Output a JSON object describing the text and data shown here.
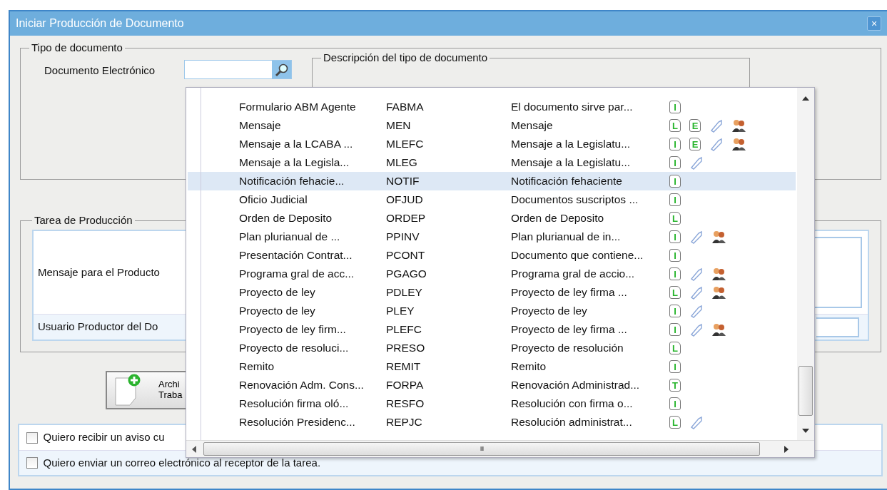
{
  "window": {
    "title": "Iniciar Producción de Documento",
    "close": "×"
  },
  "tipo_documento": {
    "legend": "Tipo de documento",
    "label": "Documento Electrónico",
    "descripcion_legend": "Descripción del tipo de documento"
  },
  "tarea": {
    "legend": "Tarea de Producción",
    "mensaje_label": "Mensaje para el Producto",
    "usuario_label": "Usuario Productor del Do"
  },
  "attach_button": {
    "line1": "Archi",
    "line2": "Traba"
  },
  "options": [
    {
      "label": "Quiero recibir un aviso cu",
      "checked": false
    },
    {
      "label": "Quiero enviar un correo electrónico al receptor de la tarea.",
      "checked": false
    }
  ],
  "dropdown": {
    "scroll_mark": "III",
    "rows": [
      {
        "name": "Formulario ABM Agente",
        "code": "FABMA",
        "description": "El documento sirve par...",
        "selected": false,
        "icons": [
          {
            "kind": "doc",
            "letter": "I"
          }
        ]
      },
      {
        "name": "Mensaje",
        "code": "MEN",
        "description": "Mensaje",
        "selected": false,
        "icons": [
          {
            "kind": "doc",
            "letter": "L"
          },
          {
            "kind": "doc",
            "letter": "E"
          },
          {
            "kind": "tag"
          },
          {
            "kind": "people"
          }
        ]
      },
      {
        "name": "Mensaje a la LCABA ...",
        "code": "MLEFC",
        "description": "Mensaje a la Legislatu...",
        "selected": false,
        "icons": [
          {
            "kind": "doc",
            "letter": "I"
          },
          {
            "kind": "doc",
            "letter": "E"
          },
          {
            "kind": "tag"
          },
          {
            "kind": "people"
          }
        ]
      },
      {
        "name": "Mensaje a la Legisla...",
        "code": "MLEG",
        "description": "Mensaje a la Legislatu...",
        "selected": false,
        "icons": [
          {
            "kind": "doc",
            "letter": "I"
          },
          {
            "kind": "tag"
          }
        ]
      },
      {
        "name": "Notificación fehacie...",
        "code": "NOTIF",
        "description": "Notificación fehaciente",
        "selected": true,
        "icons": [
          {
            "kind": "doc",
            "letter": "I"
          }
        ]
      },
      {
        "name": "Oficio Judicial",
        "code": "OFJUD",
        "description": "Documentos suscriptos ...",
        "selected": false,
        "icons": [
          {
            "kind": "doc",
            "letter": "I"
          }
        ]
      },
      {
        "name": "Orden de Deposito",
        "code": "ORDEP",
        "description": "Orden de Deposito",
        "selected": false,
        "icons": [
          {
            "kind": "doc",
            "letter": "L"
          }
        ]
      },
      {
        "name": "Plan plurianual de ...",
        "code": "PPINV",
        "description": "Plan plurianual de in...",
        "selected": false,
        "icons": [
          {
            "kind": "doc",
            "letter": "I"
          },
          {
            "kind": "tag"
          },
          {
            "kind": "people"
          }
        ]
      },
      {
        "name": "Presentación Contrat...",
        "code": "PCONT",
        "description": "Documento que contiene...",
        "selected": false,
        "icons": [
          {
            "kind": "doc",
            "letter": "I"
          }
        ]
      },
      {
        "name": "Programa gral de acc...",
        "code": "PGAGO",
        "description": "Programa gral de accio...",
        "selected": false,
        "icons": [
          {
            "kind": "doc",
            "letter": "I"
          },
          {
            "kind": "tag"
          },
          {
            "kind": "people"
          }
        ]
      },
      {
        "name": "Proyecto de ley",
        "code": "PDLEY",
        "description": "Proyecto de ley firma ...",
        "selected": false,
        "icons": [
          {
            "kind": "doc",
            "letter": "L"
          },
          {
            "kind": "tag"
          },
          {
            "kind": "people"
          }
        ]
      },
      {
        "name": "Proyecto de ley",
        "code": "PLEY",
        "description": "Proyecto de ley",
        "selected": false,
        "icons": [
          {
            "kind": "doc",
            "letter": "I"
          },
          {
            "kind": "tag"
          }
        ]
      },
      {
        "name": "Proyecto de ley firm...",
        "code": "PLEFC",
        "description": "Proyecto de ley firma ...",
        "selected": false,
        "icons": [
          {
            "kind": "doc",
            "letter": "I"
          },
          {
            "kind": "tag"
          },
          {
            "kind": "people"
          }
        ]
      },
      {
        "name": "Proyecto de resoluci...",
        "code": "PRESO",
        "description": "Proyecto de resolución",
        "selected": false,
        "icons": [
          {
            "kind": "doc",
            "letter": "L"
          }
        ]
      },
      {
        "name": "Remito",
        "code": "REMIT",
        "description": "Remito",
        "selected": false,
        "icons": [
          {
            "kind": "doc",
            "letter": "I"
          }
        ]
      },
      {
        "name": "Renovación Adm. Cons...",
        "code": "FORPA",
        "description": "Renovación Administrad...",
        "selected": false,
        "icons": [
          {
            "kind": "doc",
            "letter": "T"
          }
        ]
      },
      {
        "name": "Resolución firma oló...",
        "code": "RESFO",
        "description": "Resolución con firma o...",
        "selected": false,
        "icons": [
          {
            "kind": "doc",
            "letter": "I"
          }
        ]
      },
      {
        "name": "Resolución Presidenc...",
        "code": "REPJC",
        "description": "Resolución administrat...",
        "selected": false,
        "icons": [
          {
            "kind": "doc",
            "letter": "L"
          },
          {
            "kind": "tag"
          }
        ]
      }
    ]
  }
}
